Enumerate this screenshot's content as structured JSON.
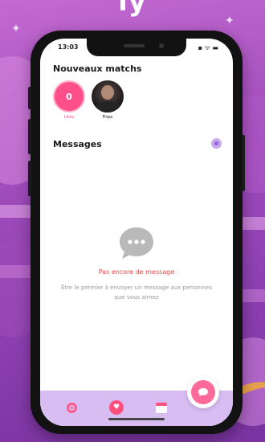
{
  "background": {
    "heading": "ly"
  },
  "status_bar": {
    "time": "13:03",
    "icons": "▪ ᯤ ▬"
  },
  "matches": {
    "title": "Nouveaux matchs",
    "items": [
      {
        "name": "Likés",
        "badge": "0",
        "kind": "likes-counter"
      },
      {
        "name": "Filipe",
        "kind": "avatar"
      }
    ]
  },
  "messages": {
    "title": "Messages"
  },
  "empty_state": {
    "icon": "chat-bubble-icon",
    "title": "Pas encore de message",
    "subtitle": "Être le premier à envoyer un message aux personnes que vous aimez"
  },
  "bottom_nav": {
    "items": [
      {
        "icon": "discover-icon"
      },
      {
        "icon": "heart-icon"
      },
      {
        "icon": "calendar-icon"
      }
    ],
    "fab_icon": "chat-icon"
  },
  "colors": {
    "accent_pink": "#ff4f8b",
    "nav_background": "#d7bdf2",
    "empty_title": "#e94545",
    "backdrop": "#a24dbd"
  }
}
